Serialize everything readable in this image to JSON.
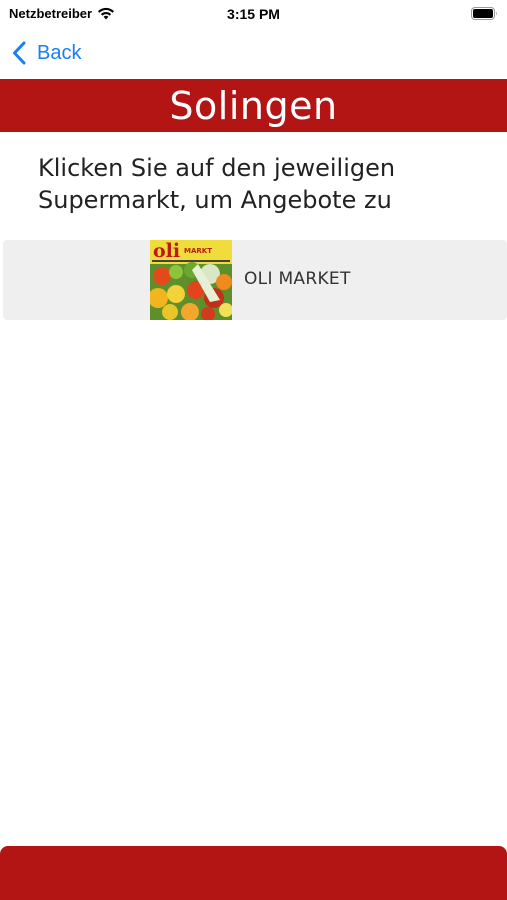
{
  "status_bar": {
    "carrier": "Netzbetreiber",
    "time": "3:15 PM",
    "wifi_icon": "wifi-icon",
    "battery_icon": "battery-icon"
  },
  "nav": {
    "back_label": "Back",
    "back_icon": "chevron-left-icon"
  },
  "header": {
    "title": "Solingen"
  },
  "instruction": "Klicken Sie auf den jeweiligen Supermarkt, um Angebote zu",
  "markets": [
    {
      "name": "OLI MARKET",
      "logo_text": "oli",
      "logo_subtext": "MARKT"
    }
  ],
  "colors": {
    "accent_red": "#b31414",
    "link_blue": "#1a7ef4",
    "row_background": "#efefef"
  }
}
